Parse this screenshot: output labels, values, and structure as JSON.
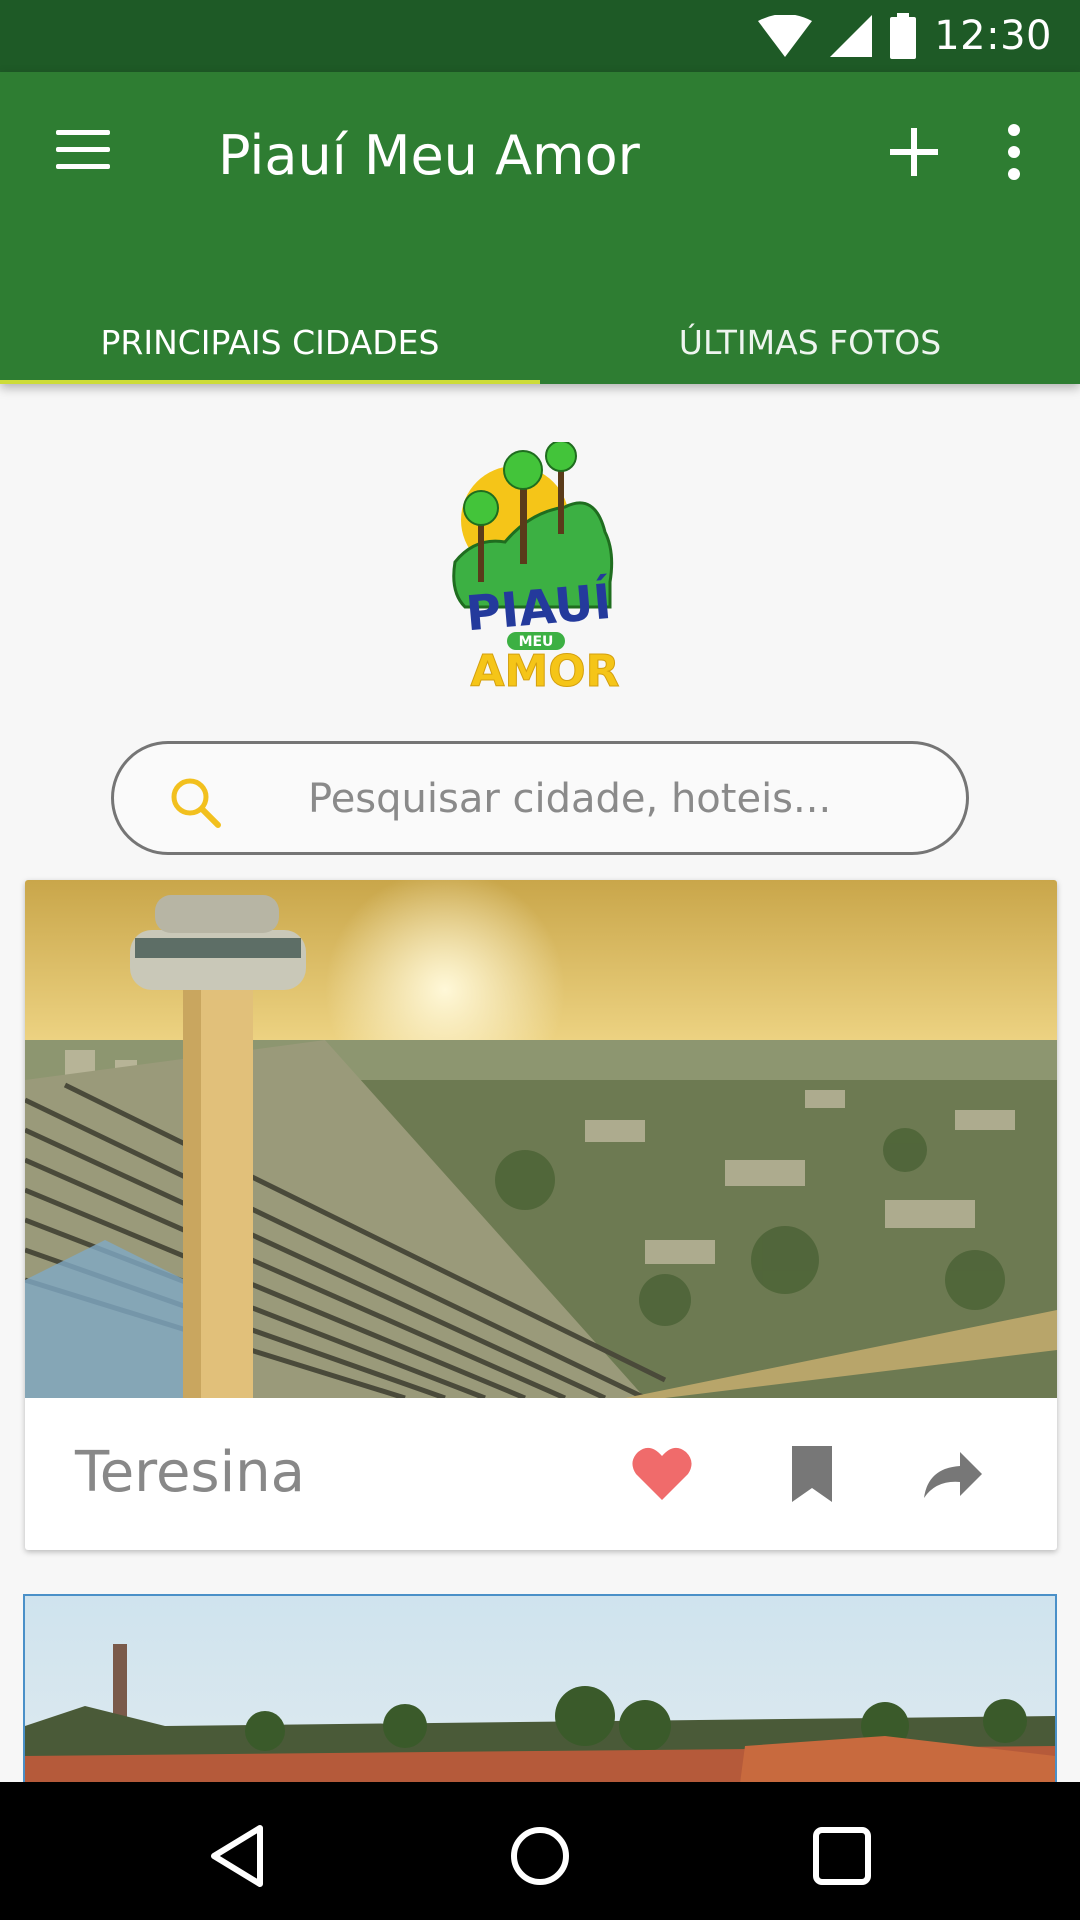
{
  "status_bar": {
    "time": "12:30"
  },
  "app_bar": {
    "title": "Piauí Meu Amor"
  },
  "tabs": [
    {
      "label": "PRINCIPAIS CIDADES",
      "active": true
    },
    {
      "label": "ÚLTIMAS FOTOS",
      "active": false
    }
  ],
  "logo": {
    "line1": "PIAUÍ",
    "line2": "MEU",
    "line3": "AMOR"
  },
  "search": {
    "placeholder": "Pesquisar cidade, hoteis..."
  },
  "cards": [
    {
      "city": "Teresina",
      "liked": true
    }
  ],
  "colors": {
    "app_bar": "#2e7d32",
    "status_bar": "#1e5a26",
    "tab_indicator": "#cddc39",
    "heart": "#f06b6b",
    "search_icon": "#f2c01e"
  },
  "icons": {
    "menu": "hamburger-icon",
    "add": "plus-icon",
    "more": "more-vertical-icon",
    "search": "search-icon",
    "like": "heart-icon",
    "save": "bookmark-icon",
    "share": "share-icon",
    "back": "back-triangle-icon",
    "home": "home-circle-icon",
    "recents": "recents-square-icon"
  }
}
